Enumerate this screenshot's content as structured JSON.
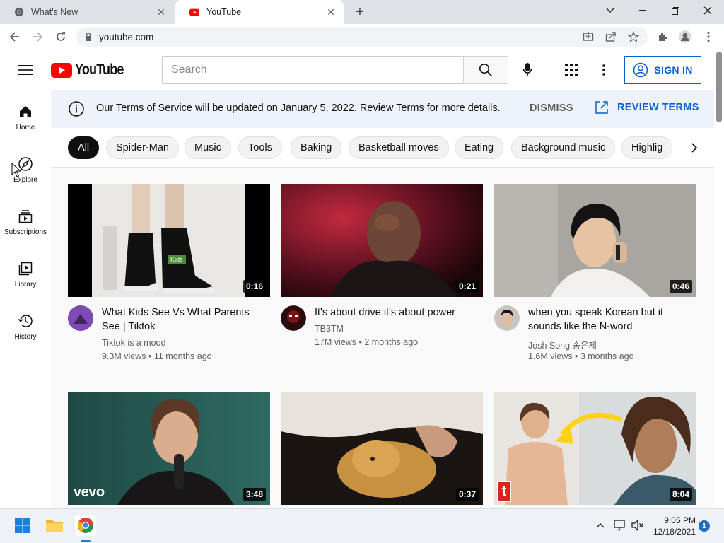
{
  "browser": {
    "tabs": [
      {
        "title": "What's New",
        "active": false
      },
      {
        "title": "YouTube",
        "active": true
      }
    ],
    "url": "youtube.com"
  },
  "masthead": {
    "logo_text": "YouTube",
    "search_placeholder": "Search",
    "sign_in_label": "SIGN IN"
  },
  "guide": {
    "items": [
      {
        "label": "Home",
        "icon": "home-icon"
      },
      {
        "label": "Explore",
        "icon": "compass-icon"
      },
      {
        "label": "Subscriptions",
        "icon": "subscriptions-icon"
      },
      {
        "label": "Library",
        "icon": "library-icon"
      },
      {
        "label": "History",
        "icon": "history-icon"
      }
    ]
  },
  "banner": {
    "message": "Our Terms of Service will be updated on January 5, 2022. Review Terms for more details.",
    "dismiss_label": "DISMISS",
    "review_label": "REVIEW TERMS"
  },
  "chips": [
    "All",
    "Spider-Man",
    "Music",
    "Tools",
    "Baking",
    "Basketball moves",
    "Eating",
    "Background music",
    "Highlig"
  ],
  "videos": [
    {
      "title": "What Kids See Vs What Parents See | Tiktok",
      "channel": "Tiktok is a mood",
      "stats": "9.3M views • 11 months ago",
      "duration": "0:16",
      "badge": "Kids"
    },
    {
      "title": "It's about drive it's about power",
      "channel": "TB3TM",
      "stats": "17M views • 2 months ago",
      "duration": "0:21"
    },
    {
      "title": "when you speak Korean but it sounds like the N-word",
      "channel": "Josh Song 송은제",
      "stats": "1.6M views • 3 months ago",
      "duration": "0:46"
    },
    {
      "title": "",
      "channel": "",
      "stats": "",
      "duration": "3:48",
      "watermark": "vevo"
    },
    {
      "title": "",
      "channel": "",
      "stats": "",
      "duration": "0:37"
    },
    {
      "title": "",
      "channel": "",
      "stats": "",
      "duration": "8:04",
      "watermark": "t"
    }
  ],
  "taskbar": {
    "time": "9:05 PM",
    "date": "12/18/2021",
    "notification_count": "1"
  },
  "colors": {
    "youtube_red": "#ff0000",
    "link_blue": "#065fd4",
    "banner_bg": "#eef3fa"
  }
}
